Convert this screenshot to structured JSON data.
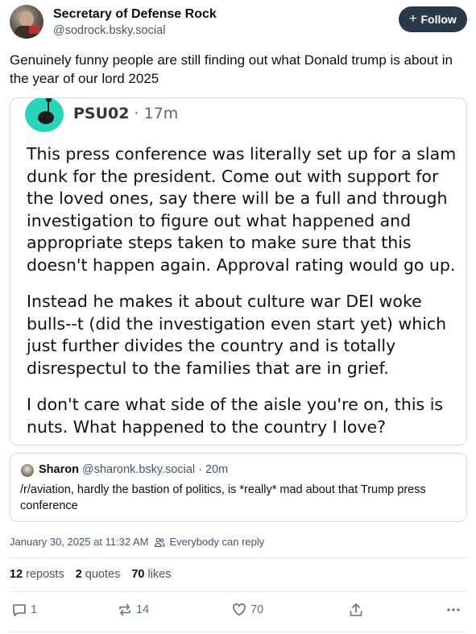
{
  "author": {
    "display_name": "Secretary of Defense Rock",
    "handle": "@sodrock.bsky.social",
    "follow_label": "Follow"
  },
  "post": {
    "text": "Genuinely funny people are still finding out what Donald trump is about in the year of our lord 2025"
  },
  "embed_image": {
    "username": "PSU02",
    "time": "17m",
    "paragraphs": [
      "This press conference was literally set up for a slam dunk for the president. Come out with support for the loved ones, say there will be a full and through investigation to figure out what happened and appropriate steps taken to make sure that this doesn't happen again. Approval rating would go up.",
      "Instead he makes it about culture war DEI woke bulls--t (did the investigation even start yet) which just further divides the country and is totally disrespectul to the families that are in grief.",
      "I don't care what side of the aisle you're on, this is nuts. What happened to the country I love?"
    ]
  },
  "quote": {
    "name": "Sharon",
    "handle": "@sharonk.bsky.social",
    "time": "20m",
    "text": "/r/aviation, hardly the bastion of politics, is *really* mad about that Trump press conference"
  },
  "meta": {
    "timestamp": "January 30, 2025 at 11:32 AM",
    "reply_setting": "Everybody can reply"
  },
  "stats": {
    "reposts_count": "12",
    "reposts_label": "reposts",
    "quotes_count": "2",
    "quotes_label": "quotes",
    "likes_count": "70",
    "likes_label": "likes"
  },
  "actions": {
    "reply_count": "1",
    "repost_count": "14",
    "like_count": "70"
  },
  "colors": {
    "follow_button": "#2b3a4b",
    "muted_text": "#42576c",
    "border": "#d4dbe2",
    "reddit_avatar": "#2ad4b8"
  },
  "icons": [
    "plus-icon",
    "people-icon",
    "reply-icon",
    "repost-icon",
    "like-icon",
    "share-icon",
    "more-icon"
  ]
}
